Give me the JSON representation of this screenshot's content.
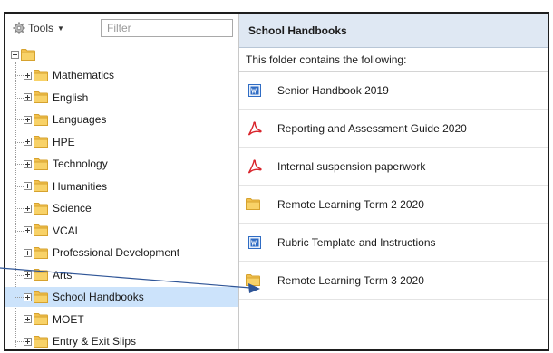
{
  "toolbar": {
    "tools_label": "Tools",
    "filter_placeholder": "Filter",
    "filter_value": ""
  },
  "tree": {
    "items": [
      {
        "label": "Mathematics"
      },
      {
        "label": "English"
      },
      {
        "label": "Languages"
      },
      {
        "label": "HPE"
      },
      {
        "label": "Technology"
      },
      {
        "label": "Humanities"
      },
      {
        "label": "Science"
      },
      {
        "label": "VCAL"
      },
      {
        "label": "Professional Development"
      },
      {
        "label": "Arts"
      },
      {
        "label": "School Handbooks",
        "selected": true
      },
      {
        "label": "MOET"
      },
      {
        "label": "Entry & Exit Slips"
      }
    ]
  },
  "content": {
    "title": "School Handbooks",
    "subtitle": "This folder contains the following:",
    "items": [
      {
        "label": "Senior Handbook 2019",
        "icon": "word-document-icon"
      },
      {
        "label": "Reporting and Assessment Guide 2020",
        "icon": "pdf-icon"
      },
      {
        "label": "Internal suspension paperwork",
        "icon": "pdf-icon"
      },
      {
        "label": "Remote Learning Term 2 2020",
        "icon": "folder-icon"
      },
      {
        "label": "Rubric Template and Instructions",
        "icon": "word-document-icon"
      },
      {
        "label": "Remote Learning Term 3 2020",
        "icon": "folder-icon"
      }
    ]
  },
  "colors": {
    "selection": "#cce3fb",
    "header_background": "#dfe8f3",
    "folder": "#f5c542",
    "pdf": "#d9252c",
    "word": "#2f6cc4",
    "annotation_arrow": "#2f5597"
  }
}
